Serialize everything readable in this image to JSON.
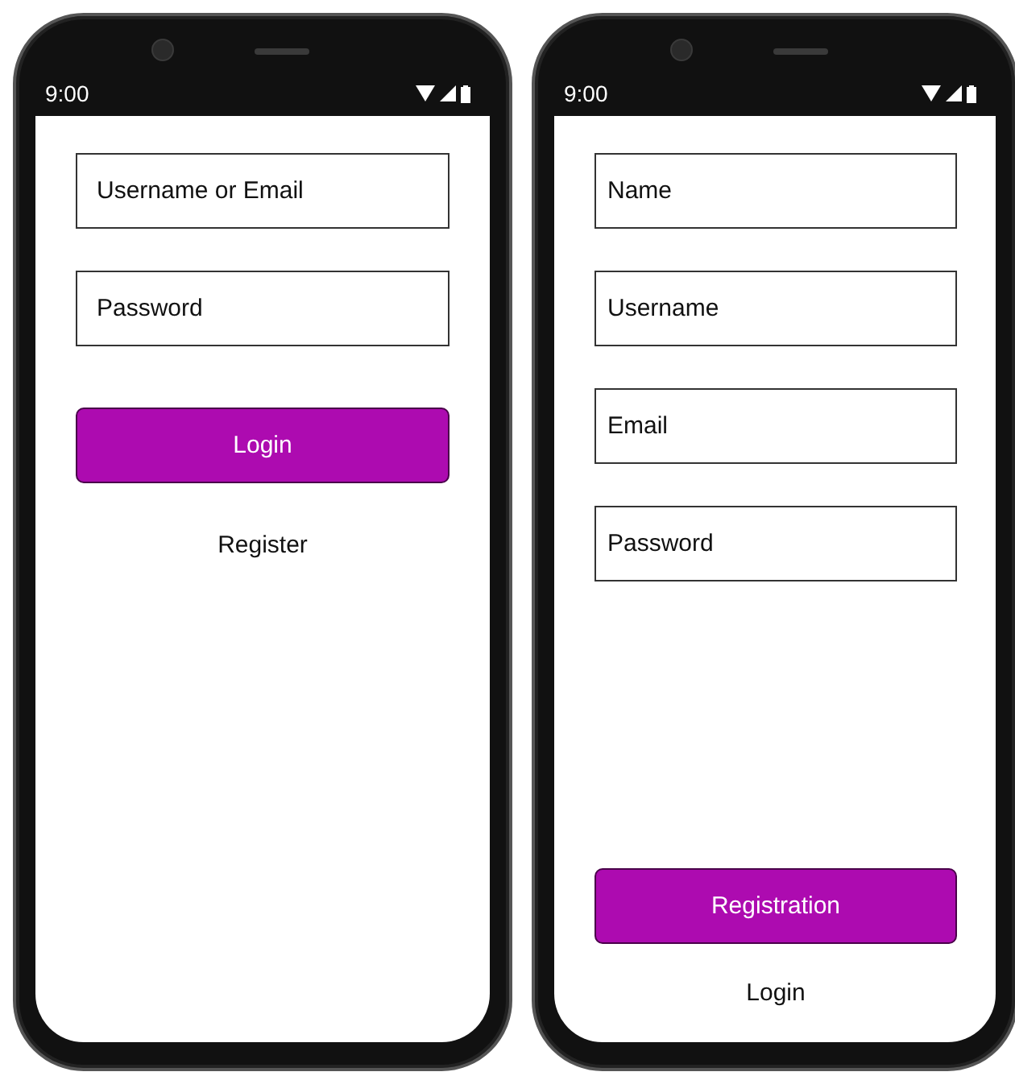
{
  "phones": [
    {
      "kind": "login",
      "status_time": "9:00",
      "fields": [
        {
          "placeholder": "Username or Email"
        },
        {
          "placeholder": "Password"
        }
      ],
      "actions": [
        {
          "kind": "button",
          "label": "Login"
        },
        {
          "kind": "link",
          "label": "Register"
        }
      ]
    },
    {
      "kind": "registration",
      "status_time": "9:00",
      "fields": [
        {
          "placeholder": "Name"
        },
        {
          "placeholder": "Username"
        },
        {
          "placeholder": "Email"
        },
        {
          "placeholder": "Password"
        }
      ],
      "actions": [
        {
          "kind": "button",
          "label": "Registration"
        },
        {
          "kind": "link",
          "label": "Login"
        }
      ]
    }
  ]
}
